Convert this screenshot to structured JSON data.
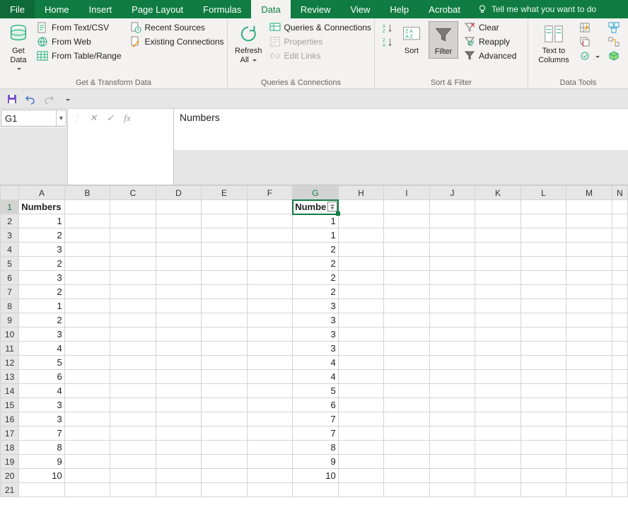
{
  "tabs": {
    "file": "File",
    "items": [
      "Home",
      "Insert",
      "Page Layout",
      "Formulas",
      "Data",
      "Review",
      "View",
      "Help",
      "Acrobat"
    ],
    "active": "Data",
    "tell": "Tell me what you want to do"
  },
  "ribbon": {
    "transform": {
      "label": "Get & Transform Data",
      "get_data": "Get Data",
      "from_text": "From Text/CSV",
      "from_web": "From Web",
      "from_table": "From Table/Range",
      "recent": "Recent Sources",
      "existing": "Existing Connections"
    },
    "queries": {
      "label": "Queries & Connections",
      "refresh": "Refresh All",
      "qc": "Queries & Connections",
      "props": "Properties",
      "edit": "Edit Links"
    },
    "sortfilter": {
      "label": "Sort & Filter",
      "sort": "Sort",
      "filter": "Filter",
      "clear": "Clear",
      "reapply": "Reapply",
      "advanced": "Advanced"
    },
    "datatools": {
      "label": "Data Tools",
      "ttc": "Text to Columns"
    }
  },
  "namebox": "G1",
  "formula": "Numbers",
  "columns": [
    "A",
    "B",
    "C",
    "D",
    "E",
    "F",
    "G",
    "H",
    "I",
    "J",
    "K",
    "L",
    "M",
    "N"
  ],
  "rows": [
    1,
    2,
    3,
    4,
    5,
    6,
    7,
    8,
    9,
    10,
    11,
    12,
    13,
    14,
    15,
    16,
    17,
    18,
    19,
    20,
    21
  ],
  "colA_header": "Numbers",
  "colA": [
    1,
    2,
    3,
    2,
    3,
    2,
    1,
    2,
    3,
    4,
    5,
    6,
    4,
    3,
    3,
    7,
    8,
    9,
    10
  ],
  "colG_header": "Numbe",
  "colG": [
    1,
    1,
    2,
    2,
    2,
    2,
    3,
    3,
    3,
    3,
    4,
    4,
    5,
    6,
    7,
    7,
    8,
    9,
    10
  ]
}
